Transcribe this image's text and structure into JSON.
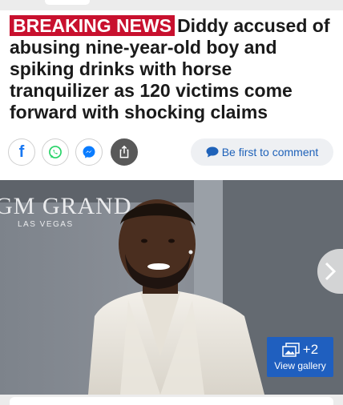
{
  "article": {
    "badge": "BREAKING NEWS",
    "headline": "Diddy accused of abusing nine-year-old boy and spiking drinks with horse tranquilizer as 120 victims come forward with shocking claims"
  },
  "share": {
    "buttons": [
      {
        "icon": "facebook-icon",
        "glyph": "f",
        "color": "#1877f2"
      },
      {
        "icon": "whatsapp-icon",
        "color": "#25d366"
      },
      {
        "icon": "messenger-icon",
        "color": "#0a7cff"
      },
      {
        "icon": "share-icon",
        "color": "#ffffff"
      }
    ],
    "comment_label": "Be first to comment",
    "comment_icon": "speech-bubble-icon"
  },
  "photo": {
    "backdrop_text_1": "GM GRAND",
    "backdrop_text_2": "LAS VEGAS",
    "gallery_count": "+2",
    "gallery_label": "View gallery",
    "next_icon": "chevron-right-icon"
  },
  "colors": {
    "badge": "#c8102e",
    "link": "#1f62b9",
    "gallery": "#1f5fbf"
  }
}
